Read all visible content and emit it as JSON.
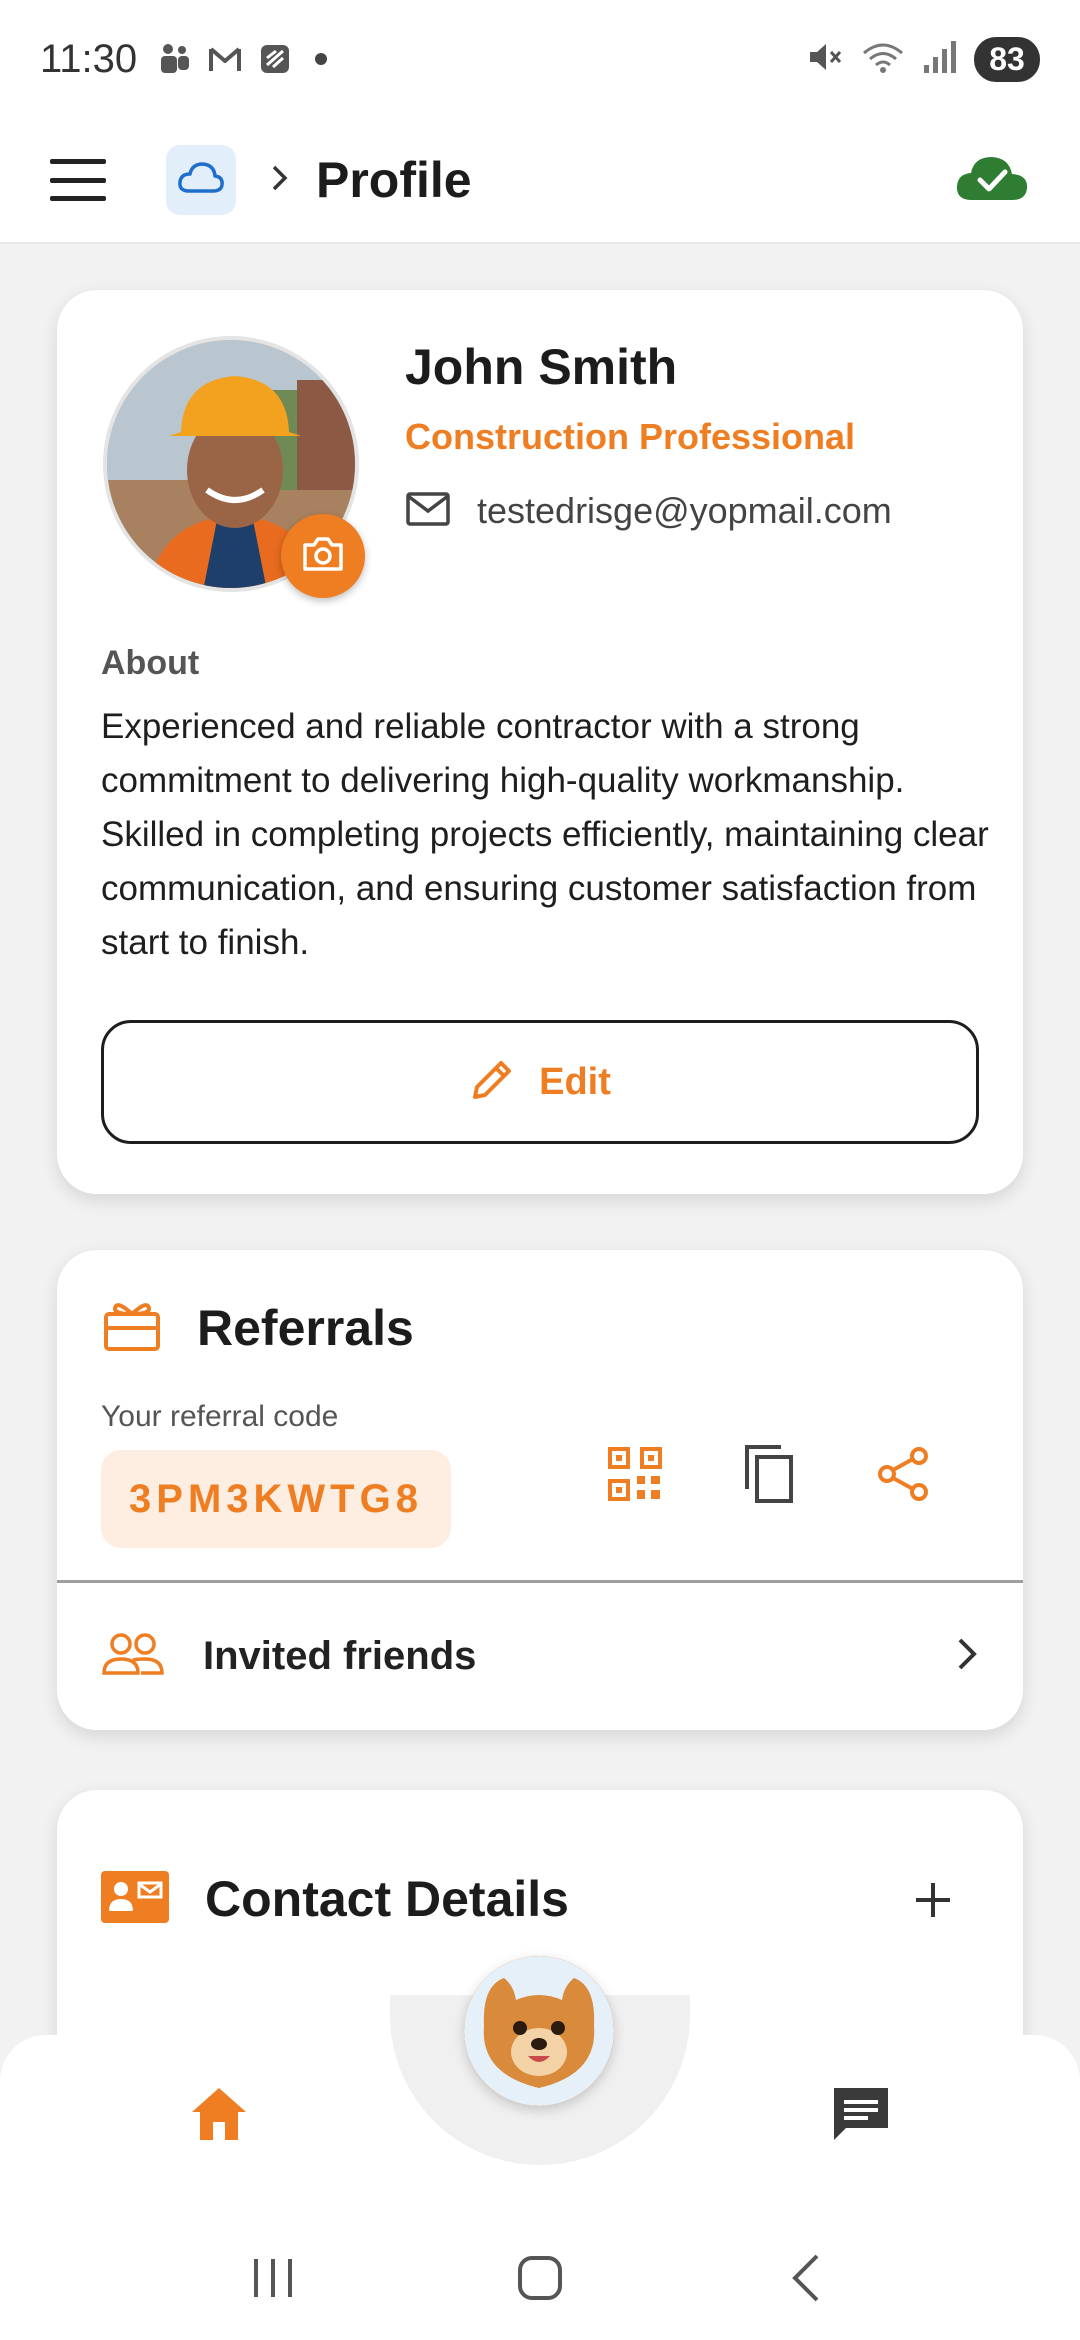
{
  "status_bar": {
    "time": "11:30",
    "battery": "83",
    "icons": [
      "teams-icon",
      "gmail-icon",
      "app-icon",
      "dot",
      "mute-icon",
      "wifi-icon",
      "signal-icon"
    ]
  },
  "app_bar": {
    "title": "Profile",
    "icons": [
      "menu-icon",
      "cloud-icon",
      "chevron-right-icon",
      "sync-check-icon"
    ]
  },
  "profile": {
    "name": "John Smith",
    "role": "Construction Professional",
    "email": "testedrisge@yopmail.com",
    "about_label": "About",
    "about_text": "Experienced and reliable contractor with a strong commitment to delivering high-quality workmanship. Skilled in completing projects efficiently, maintaining clear communication, and ensuring customer satisfaction from start to finish.",
    "edit_label": "Edit"
  },
  "referrals": {
    "title": "Referrals",
    "code_label": "Your referral code",
    "code": "3PM3KWTG8",
    "invited_label": "Invited friends"
  },
  "contact": {
    "title": "Contact Details"
  },
  "colors": {
    "accent": "#ef7d22",
    "sync_green": "#2e7d32",
    "cloud_blue": "#1e6ecc"
  }
}
